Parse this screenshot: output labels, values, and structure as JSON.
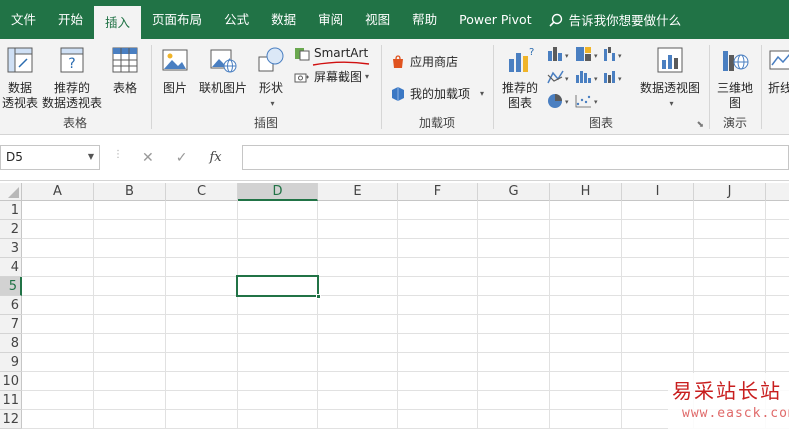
{
  "tabs": [
    "文件",
    "开始",
    "插入",
    "页面布局",
    "公式",
    "数据",
    "审阅",
    "视图",
    "帮助",
    "Power Pivot"
  ],
  "active_tab": "插入",
  "tell_me": "告诉我你想要做什么",
  "groups": {
    "tables": {
      "label": "表格",
      "pivot_table": "数据\n透视表",
      "recommended_pivot": "推荐的\n数据透视表",
      "table": "表格"
    },
    "illustrations": {
      "label": "插图",
      "pictures": "图片",
      "online_pictures": "联机图片",
      "shapes": "形状",
      "smartart": "SmartArt",
      "screenshot": "屏幕截图"
    },
    "addins": {
      "label": "加载项",
      "store": "应用商店",
      "my_addins": "我的加载项"
    },
    "charts": {
      "label": "图表",
      "recommended_charts": "推荐的\n图表",
      "pivot_chart": "数据透视图"
    },
    "tours": {
      "label": "演示",
      "map3d": "三维地\n图"
    },
    "sparklines": {
      "line": "折线"
    }
  },
  "formula_bar": {
    "name_box": "D5",
    "cancel": "✕",
    "enter": "✓",
    "fx": "fx",
    "value": ""
  },
  "columns": [
    "A",
    "B",
    "C",
    "D",
    "E",
    "F",
    "G",
    "H",
    "I",
    "J"
  ],
  "rows": [
    "1",
    "2",
    "3",
    "4",
    "5",
    "6",
    "7",
    "8",
    "9",
    "10",
    "11",
    "12"
  ],
  "selected_column": "D",
  "selected_row": "5",
  "watermark": {
    "cn": "易采站长站",
    "url": "www.easck.com"
  },
  "colors": {
    "accent": "#217346",
    "smartart_underline": "#d01010",
    "watermark": "#c81e1e"
  }
}
